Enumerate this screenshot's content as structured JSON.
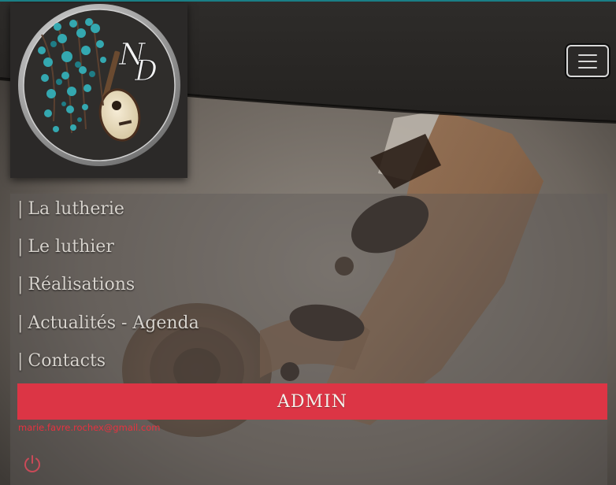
{
  "header": {
    "logo": {
      "monogram": "ND",
      "icon": "logo-mandolin-wisteria"
    },
    "menu_toggle": {
      "icon": "hamburger-icon"
    }
  },
  "nav": {
    "items": [
      {
        "label": "La lutherie"
      },
      {
        "label": "Le luthier"
      },
      {
        "label": "Réalisations"
      },
      {
        "label": "Actualités - Agenda"
      },
      {
        "label": "Contacts"
      }
    ],
    "separator": "|"
  },
  "admin": {
    "button_label": "ADMIN",
    "email": "marie.favre.rochex@gmail.com",
    "logout_icon": "power-icon"
  },
  "colors": {
    "accent": "#dc3545",
    "header_bg": "#2b2928",
    "top_line": "#1a7f86",
    "nav_text": "#d7d3cd"
  }
}
